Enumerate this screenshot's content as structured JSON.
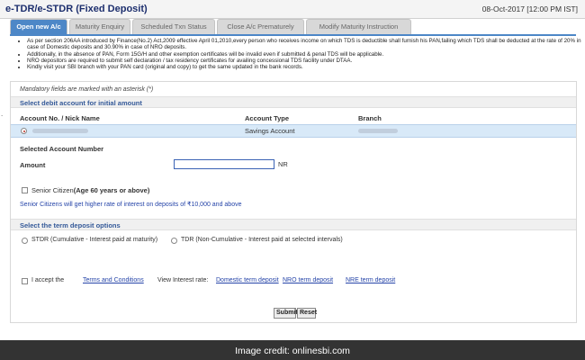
{
  "header": {
    "title": "e-TDR/e-STDR (Fixed Deposit)",
    "timestamp": "08-Oct-2017 [12:00 PM IST]"
  },
  "tabs": [
    {
      "label": "Open new A/c",
      "active": true
    },
    {
      "label": "Maturity Enquiry",
      "active": false
    },
    {
      "label": "Scheduled Txn Status",
      "active": false
    },
    {
      "label": "Close A/c Prematurely",
      "active": false
    },
    {
      "label": "Modify Maturity Instruction",
      "active": false
    }
  ],
  "notes": [
    "As per section 206AA introduced by Finance(No.2) Act,2009 effective April 01,2010,every person who receives income on which TDS is deductible shall furnish his PAN,failing which TDS shall be deducted at the rate of 20% in case of Domestic deposits and 30.90% in case of NRO deposits.",
    "Additionally, in the absence of PAN, Form 15G/H and other exemption certificates will be invalid even if submitted & penal TDS will be applicable.",
    "NRO depositors are required to submit self declaration / tax residency certificates for availing concessional TDS facility under DTAA.",
    "Kindly visit your SBI branch with your PAN card (original and copy) to get the same updated in the bank records."
  ],
  "form": {
    "mandatory_note": "Mandatory fields are marked with an asterisk (*)",
    "select_account_heading": "Select debit account for initial amount",
    "table": {
      "columns": [
        "Account No. / Nick Name",
        "Account Type",
        "Branch"
      ],
      "rows": [
        {
          "account_type": "Savings Account",
          "selected": true
        }
      ]
    },
    "selected_account_label": "Selected Account Number",
    "amount_label": "Amount",
    "amount_value": "",
    "currency_suffix": "NR",
    "senior_label": "Senior Citizen",
    "senior_suffix": "(Age 60 years or above)",
    "senior_info": "Senior Citizens will get higher rate of interest on deposits of ₹10,000 and above",
    "term_heading": "Select the term deposit options",
    "options": [
      {
        "label": "STDR (Cumulative - Interest paid at maturity)"
      },
      {
        "label": "TDR (Non-Cumulative - Interest paid at selected intervals)"
      }
    ],
    "accept_label": "I accept the",
    "terms_link": "Terms and Conditions",
    "view_rate_label": "View Interest rate:",
    "rate_links": [
      "Domestic term deposit",
      "NRO term deposit",
      "NRE term deposit"
    ],
    "submit_label": "Submit",
    "reset_label": "Reset"
  },
  "footer": {
    "credit": "Image credit: onlinesbi.com"
  },
  "colors": {
    "accent": "#4d87c7",
    "title": "#1d2f6e",
    "link": "#2544a8",
    "selected_row": "#d8e9f8",
    "credit_bar": "#333333"
  }
}
